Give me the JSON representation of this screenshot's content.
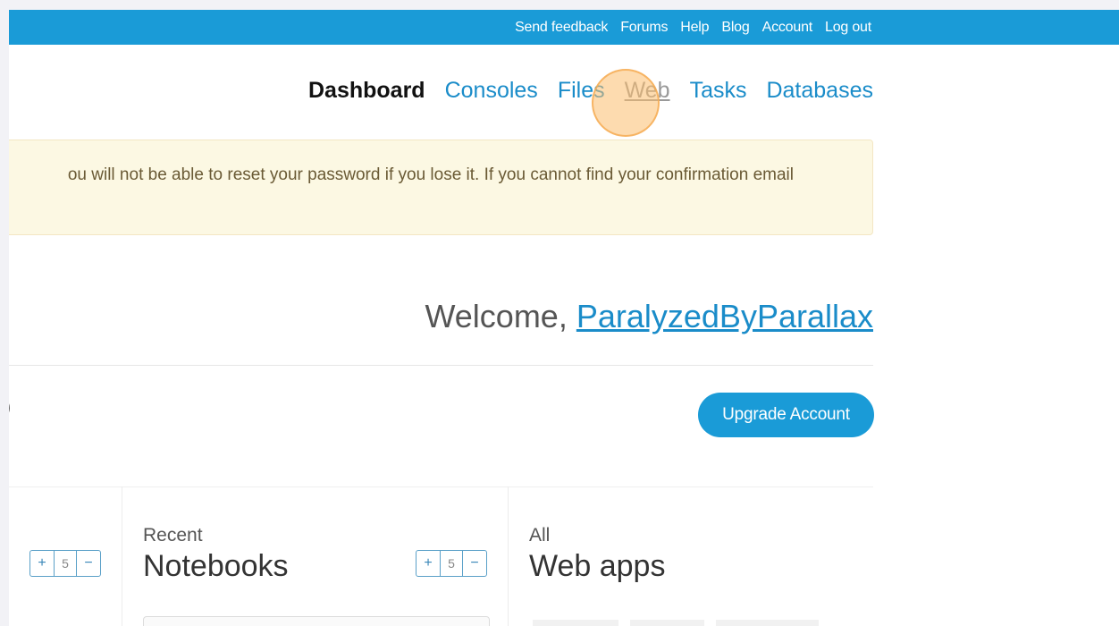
{
  "topbar": {
    "links": [
      "Send feedback",
      "Forums",
      "Help",
      "Blog",
      "Account",
      "Log out"
    ]
  },
  "nav": {
    "items": [
      "Dashboard",
      "Consoles",
      "Files",
      "Web",
      "Tasks",
      "Databases"
    ],
    "active": "Dashboard",
    "hovered": "Web"
  },
  "banner": {
    "text": "ou will not be able to reset your password if you lose it. If you cannot find your confirmation email"
  },
  "welcome": {
    "prefix": "Welcome, ",
    "username": "ParalyzedByParallax"
  },
  "stray_glyph": ")",
  "upgrade_button": "Upgrade Account",
  "panels": {
    "first_stepper": {
      "plus": "+",
      "value": "5",
      "minus": "−"
    },
    "notebooks": {
      "subtitle": "Recent",
      "title": "Notebooks",
      "stepper": {
        "plus": "+",
        "value": "5",
        "minus": "−"
      }
    },
    "webapps": {
      "subtitle": "All",
      "title": "Web apps"
    }
  },
  "colors": {
    "brand_blue": "#1a9bd7",
    "link_blue": "#1a8cc9",
    "banner_bg": "#fcf8e3"
  }
}
